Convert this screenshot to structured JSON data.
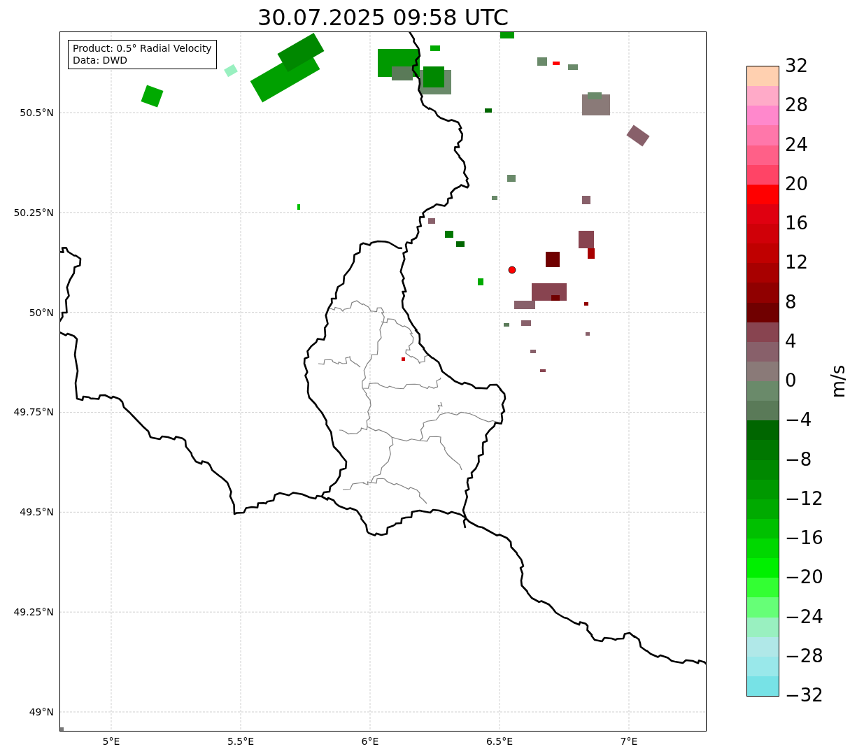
{
  "title": "30.07.2025 09:58 UTC",
  "legend": {
    "lines": [
      "Product: 0.5° Radial Velocity",
      "Data: DWD"
    ]
  },
  "map": {
    "xticks": [
      "5°E",
      "5.5°E",
      "6°E",
      "6.5°E",
      "7°E"
    ],
    "yticks": [
      "50.5°N",
      "50.25°N",
      "50°N",
      "49.75°N",
      "49.5°N",
      "49.25°N",
      "49°N"
    ]
  },
  "colorbar": {
    "label": "m/s",
    "ticks": [
      "32",
      "28",
      "24",
      "20",
      "16",
      "12",
      "8",
      "4",
      "0",
      "−4",
      "−8",
      "−12",
      "−16",
      "−20",
      "−24",
      "−28",
      "−32"
    ],
    "bands": [
      {
        "color": "#ffd0b0"
      },
      {
        "color": "#ffaac8"
      },
      {
        "color": "#ff88cc"
      },
      {
        "color": "#ff77aa"
      },
      {
        "color": "#ff6088"
      },
      {
        "color": "#ff4466"
      },
      {
        "color": "#ff0000"
      },
      {
        "color": "#e00010"
      },
      {
        "color": "#d00008"
      },
      {
        "color": "#c00000"
      },
      {
        "color": "#a80000"
      },
      {
        "color": "#900000"
      },
      {
        "color": "#700000"
      },
      {
        "color": "#884450"
      },
      {
        "color": "#88606a"
      },
      {
        "color": "#8a7a78"
      },
      {
        "color": "#6a8a6a"
      },
      {
        "color": "#5a7a58"
      },
      {
        "color": "#006600"
      },
      {
        "color": "#007700"
      },
      {
        "color": "#008800"
      },
      {
        "color": "#009900"
      },
      {
        "color": "#00aa00"
      },
      {
        "color": "#00c000"
      },
      {
        "color": "#00d800"
      },
      {
        "color": "#00f000"
      },
      {
        "color": "#33ff33"
      },
      {
        "color": "#66ff77"
      },
      {
        "color": "#99f0c0"
      },
      {
        "color": "#b0e8e8"
      },
      {
        "color": "#99e8ea"
      },
      {
        "color": "#77e2e6"
      }
    ]
  }
}
